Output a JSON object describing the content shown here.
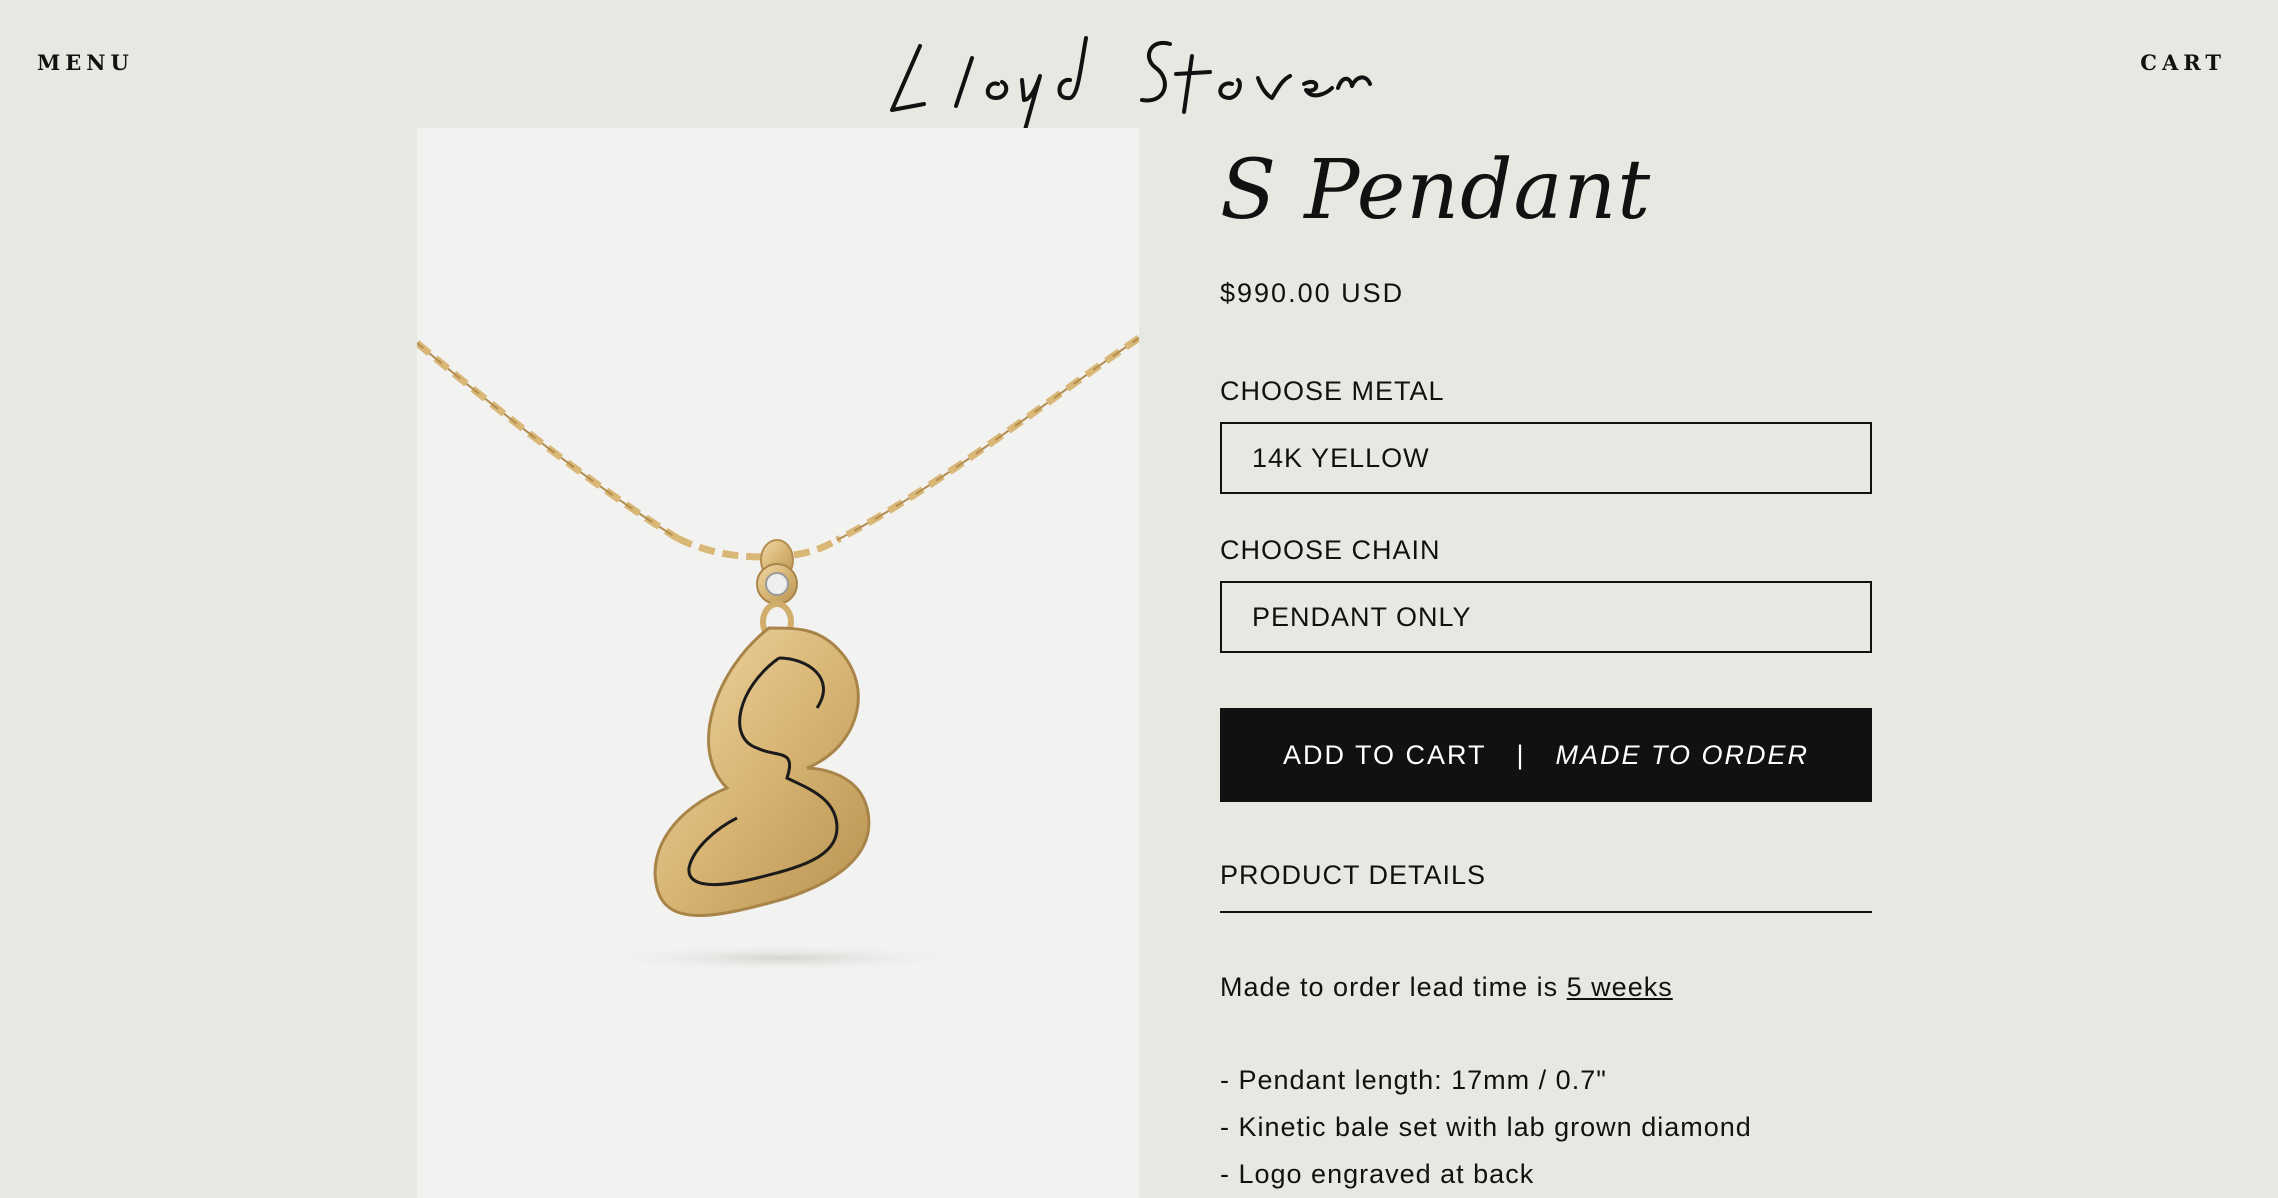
{
  "header": {
    "menu_label": "MENU",
    "cart_label": "CART",
    "logo_text": "Lloyd Stevens"
  },
  "product": {
    "title": "S Pendant",
    "price": "$990.00 USD",
    "metal_label": "CHOOSE METAL",
    "metal_value": "14K YELLOW",
    "chain_label": "CHOOSE CHAIN",
    "chain_value": "PENDANT ONLY",
    "add_to_cart_label": "ADD TO CART",
    "separator": "|",
    "made_to_order_label": "MADE TO ORDER",
    "details_heading": "PRODUCT DETAILS",
    "lead_time_prefix": "Made to order lead time is ",
    "lead_time_link": "5 weeks",
    "specs": [
      "- Pendant length: 17mm / 0.7\"",
      "- Kinetic bale set with lab grown diamond",
      "- Logo engraved at back"
    ]
  },
  "colors": {
    "background": "#e8e8e3",
    "image_bg": "#f2f2f1",
    "button_bg": "#111111",
    "gold": "#d9b777"
  },
  "icons": {
    "logo": "signature-logo-icon",
    "product_image": "gold-s-pendant-necklace"
  }
}
